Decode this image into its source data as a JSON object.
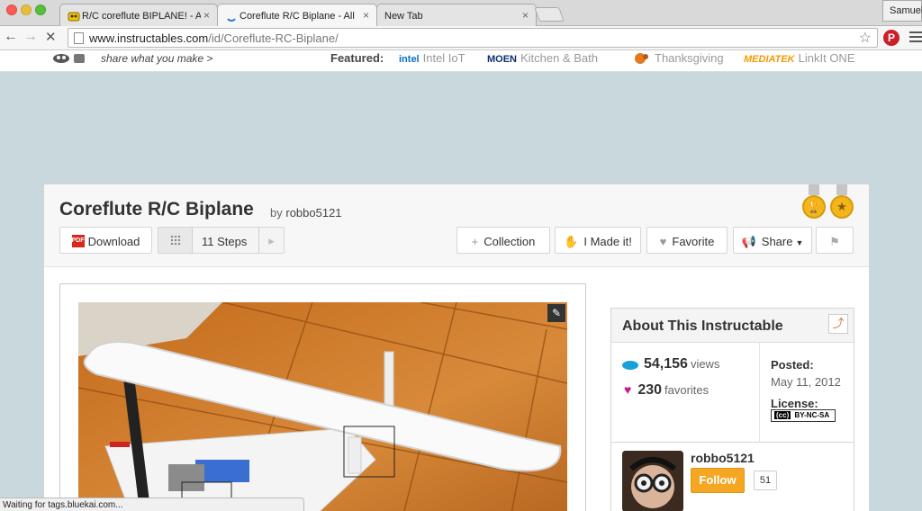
{
  "browser": {
    "tabs": [
      {
        "title": "R/C coreflute BIPLANE! - A",
        "active": false
      },
      {
        "title": "Coreflute R/C Biplane - All",
        "active": true
      },
      {
        "title": "New Tab",
        "active": false
      }
    ],
    "profile_name": "Samuel",
    "url_host": "www.instructables.com",
    "url_path": "/id/Coreflute-RC-Biplane/",
    "status_text": "Waiting for tags.bluekai.com..."
  },
  "site_strip": {
    "tagline": "share what you make >",
    "featured_label": "Featured:",
    "featured": [
      {
        "logo": "intel",
        "name": "Intel IoT",
        "color": "#0a6fc2"
      },
      {
        "logo": "MOEN",
        "name": "Kitchen & Bath",
        "color": "#0b2f6e"
      },
      {
        "logo": "",
        "name": "Thanksgiving",
        "color": "#e07a1f"
      },
      {
        "logo": "MEDIATEK",
        "name": "LinkIt ONE",
        "color": "#f29b00"
      }
    ]
  },
  "project": {
    "title": "Coreflute R/C Biplane",
    "by_prefix": "by",
    "author": "robbo5121",
    "buttons": {
      "download": "Download",
      "steps": "11 Steps",
      "collection": "Collection",
      "made_it": "I Made it!",
      "favorite": "Favorite",
      "share": "Share"
    }
  },
  "about": {
    "title": "About This Instructable",
    "views": "54,156",
    "views_label": "views",
    "favorites": "230",
    "favorites_label": "favorites",
    "posted_label": "Posted:",
    "posted_date": "May 11, 2012",
    "license_label": "License:",
    "license_badge": "BY-NC-SA"
  },
  "author_box": {
    "name": "robbo5121",
    "follow_label": "Follow",
    "followers": "51"
  },
  "colors": {
    "page_bg": "#c9d8dd",
    "follow_orange": "#f5a623",
    "views_blue": "#1aa0d8",
    "favorites_magenta": "#c8198a"
  }
}
